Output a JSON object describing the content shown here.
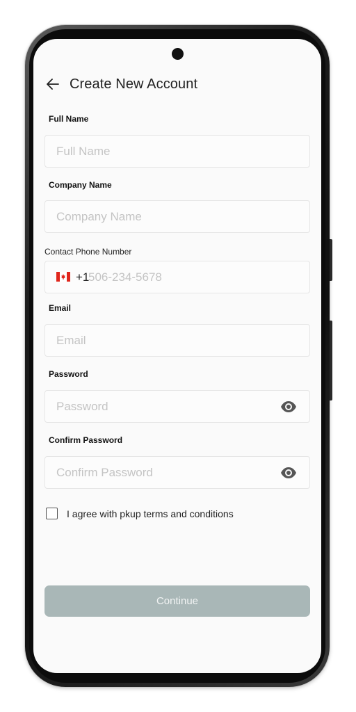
{
  "header": {
    "title": "Create New Account"
  },
  "form": {
    "full_name": {
      "label": "Full Name",
      "placeholder": "Full Name",
      "value": ""
    },
    "company_name": {
      "label": "Company Name",
      "placeholder": "Company Name",
      "value": ""
    },
    "phone": {
      "label": "Contact Phone Number",
      "country_code": "+1",
      "placeholder": "506-234-5678",
      "value": "",
      "flag": "canada-flag-icon"
    },
    "email": {
      "label": "Email",
      "placeholder": "Email",
      "value": ""
    },
    "password": {
      "label": "Password",
      "placeholder": "Password",
      "value": "",
      "toggle_icon": "eye-icon"
    },
    "confirm_password": {
      "label": "Confirm Password",
      "placeholder": "Confirm Password",
      "value": "",
      "toggle_icon": "eye-icon"
    },
    "terms": {
      "label": "I agree with pkup terms and conditions",
      "checked": false
    },
    "continue_label": "Continue"
  },
  "colors": {
    "button_disabled": "#a9b7b7",
    "screen_bg": "#fafafa",
    "field_border": "#e5e5e5",
    "placeholder": "#c4c4c4"
  }
}
